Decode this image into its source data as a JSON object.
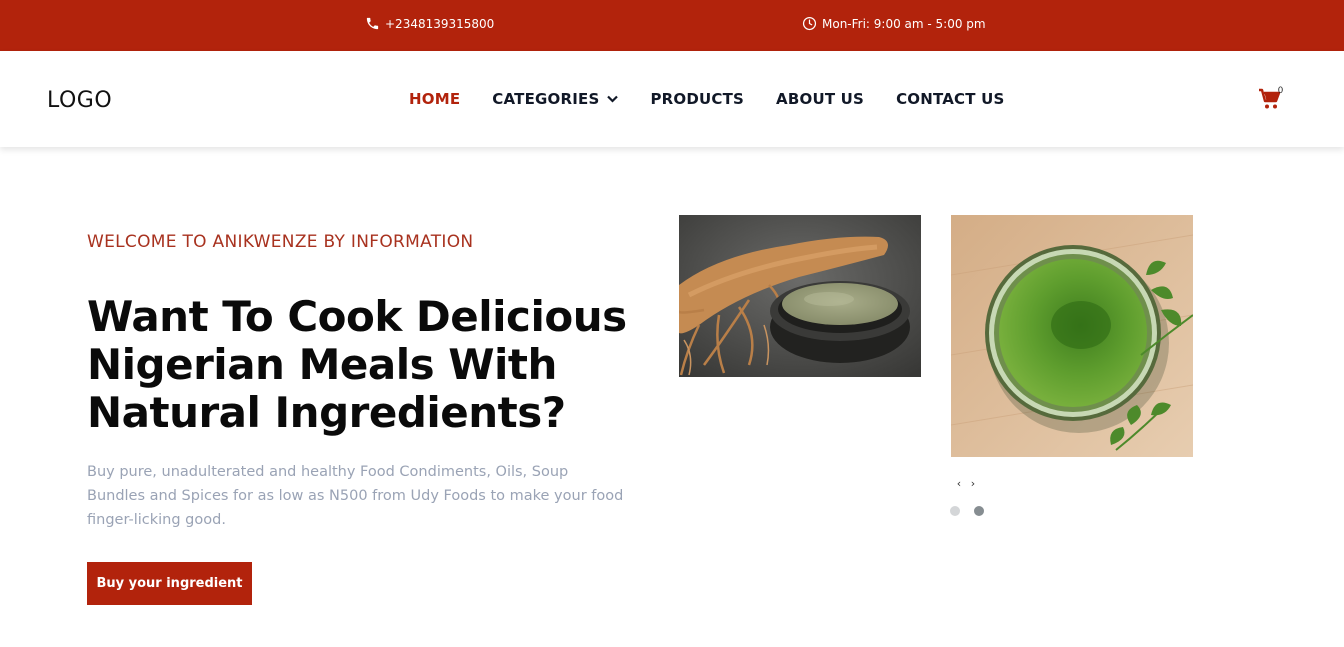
{
  "topbar": {
    "phone": "+2348139315800",
    "hours": "Mon-Fri: 9:00 am - 5:00 pm",
    "icons": {
      "phone": "phone-icon",
      "hours": "clock-icon"
    },
    "background": "#b2230c"
  },
  "header": {
    "logo": "LOGO",
    "nav": [
      {
        "label": "HOME",
        "active": true
      },
      {
        "label": "CATEGORIES",
        "dropdown": true
      },
      {
        "label": "PRODUCTS"
      },
      {
        "label": "ABOUT US"
      },
      {
        "label": "CONTACT US"
      }
    ],
    "cart": {
      "icon": "cart-icon",
      "count": "0"
    }
  },
  "hero": {
    "eyebrow": "WELCOME TO ANIKWENZE BY INFORMATION",
    "title_lines": [
      "Want To Cook Delicious",
      "Nigerian Meals With",
      "Natural Ingredients?"
    ],
    "description": "Buy pure, unadulterated and healthy Food Condiments, Oils, Soup Bundles and Spices for as low as N500 from Udy Foods to make your food finger-licking good.",
    "cta": "Buy your ingredient"
  },
  "slider": {
    "prev": "‹",
    "next": "›",
    "active_dot": 1,
    "dot_count": 2
  },
  "colors": {
    "accent": "#b2230c",
    "muted_text": "#9aa3b5"
  }
}
